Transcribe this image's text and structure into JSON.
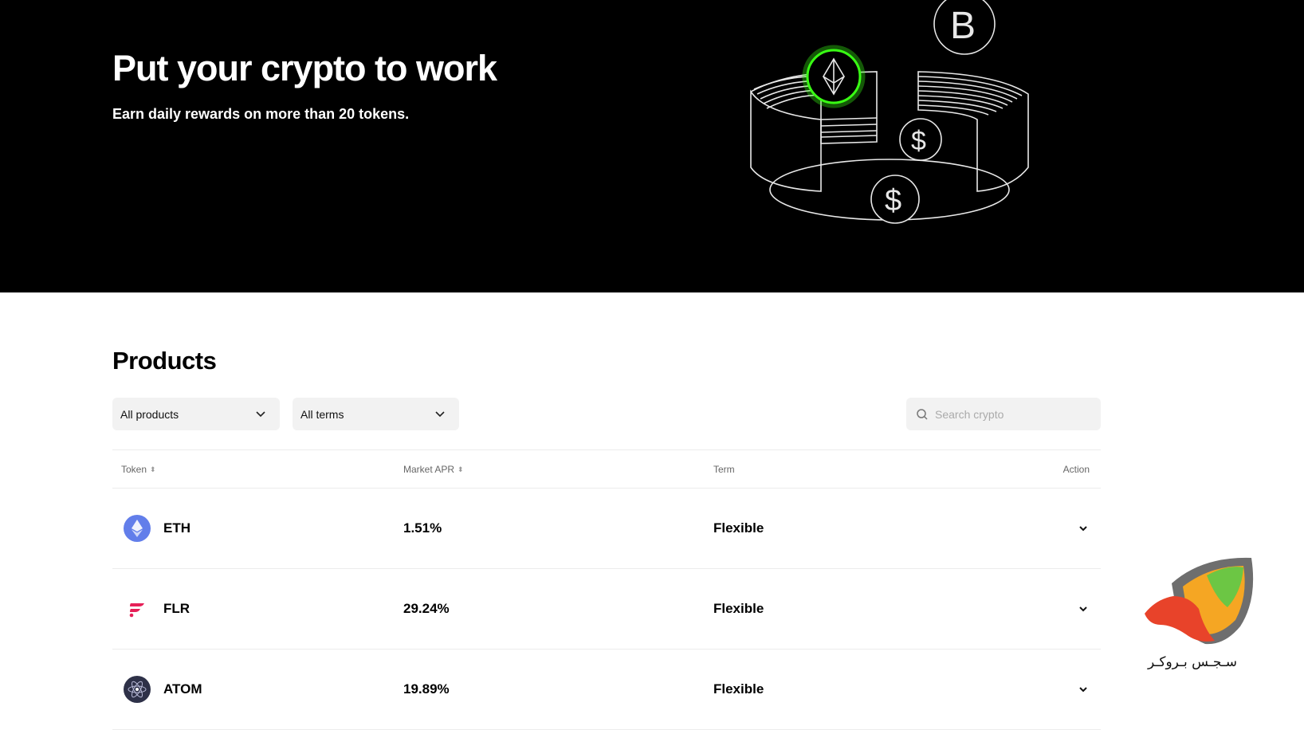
{
  "hero": {
    "title": "Put your crypto to work",
    "subtitle": "Earn daily rewards on more than 20 tokens."
  },
  "products": {
    "title": "Products",
    "filters": {
      "products_selected": "All products",
      "terms_selected": "All terms"
    },
    "search": {
      "placeholder": "Search crypto",
      "value": ""
    },
    "columns": [
      "Token",
      "Market APR",
      "Term",
      "Action"
    ],
    "rows": [
      {
        "token": "ETH",
        "apr": "1.51%",
        "term": "Flexible",
        "icon": "eth-icon",
        "color": "#627EEA"
      },
      {
        "token": "FLR",
        "apr": "29.24%",
        "term": "Flexible",
        "icon": "flr-icon",
        "color": "#E62058"
      },
      {
        "token": "ATOM",
        "apr": "19.89%",
        "term": "Flexible",
        "icon": "atom-icon",
        "color": "#2E3148"
      }
    ]
  },
  "watermark": {
    "text": "سـجـس بـروكـر"
  },
  "colors": {
    "hero_bg": "#000000",
    "accent_green": "#39FF14"
  }
}
